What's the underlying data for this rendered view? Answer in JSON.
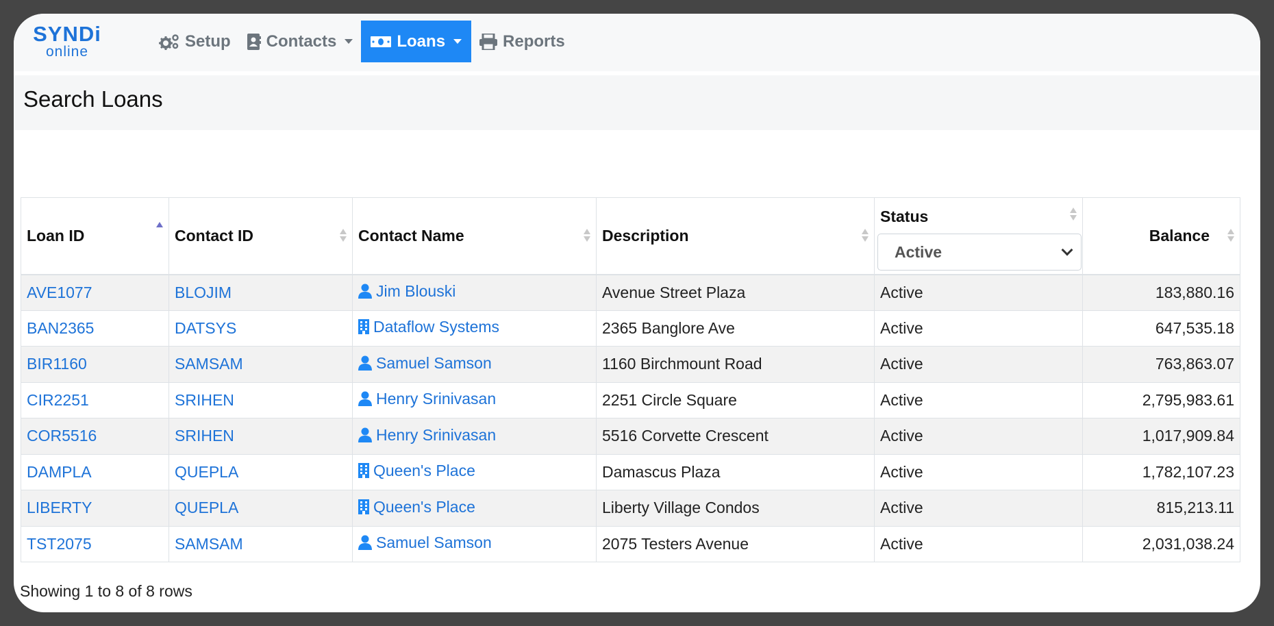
{
  "brand": {
    "top": "SYNDi",
    "bottom": "online"
  },
  "nav": {
    "setup": "Setup",
    "contacts": "Contacts",
    "loans": "Loans",
    "reports": "Reports"
  },
  "page_title": "Search Loans",
  "table": {
    "headers": {
      "loan_id": "Loan ID",
      "contact_id": "Contact ID",
      "contact_name": "Contact Name",
      "description": "Description",
      "status": "Status",
      "balance": "Balance"
    },
    "status_filter": "Active",
    "rows": [
      {
        "loan_id": "AVE1077",
        "contact_id": "BLOJIM",
        "contact_name": "Jim Blouski",
        "contact_type": "person-icon",
        "description": "Avenue Street Plaza",
        "status": "Active",
        "balance": "183,880.16"
      },
      {
        "loan_id": "BAN2365",
        "contact_id": "DATSYS",
        "contact_name": "Dataflow Systems",
        "contact_type": "building-icon",
        "description": "2365 Banglore Ave",
        "status": "Active",
        "balance": "647,535.18"
      },
      {
        "loan_id": "BIR1160",
        "contact_id": "SAMSAM",
        "contact_name": "Samuel Samson",
        "contact_type": "person-icon",
        "description": "1160 Birchmount Road",
        "status": "Active",
        "balance": "763,863.07"
      },
      {
        "loan_id": "CIR2251",
        "contact_id": "SRIHEN",
        "contact_name": "Henry Srinivasan",
        "contact_type": "person-icon",
        "description": "2251 Circle Square",
        "status": "Active",
        "balance": "2,795,983.61"
      },
      {
        "loan_id": "COR5516",
        "contact_id": "SRIHEN",
        "contact_name": "Henry Srinivasan",
        "contact_type": "person-icon",
        "description": "5516 Corvette Crescent",
        "status": "Active",
        "balance": "1,017,909.84"
      },
      {
        "loan_id": "DAMPLA",
        "contact_id": "QUEPLA",
        "contact_name": "Queen's Place",
        "contact_type": "building-icon",
        "description": "Damascus Plaza",
        "status": "Active",
        "balance": "1,782,107.23"
      },
      {
        "loan_id": "LIBERTY",
        "contact_id": "QUEPLA",
        "contact_name": "Queen's Place",
        "contact_type": "building-icon",
        "description": "Liberty Village Condos",
        "status": "Active",
        "balance": "815,213.11"
      },
      {
        "loan_id": "TST2075",
        "contact_id": "SAMSAM",
        "contact_name": "Samuel Samson",
        "contact_type": "person-icon",
        "description": "2075 Testers Avenue",
        "status": "Active",
        "balance": "2,031,038.24"
      }
    ]
  },
  "footer": {
    "pagination_info": "Showing 1 to 8 of 8 rows"
  },
  "colors": {
    "accent": "#1e88f5",
    "link": "#1e73d8",
    "frame": "#454545"
  }
}
